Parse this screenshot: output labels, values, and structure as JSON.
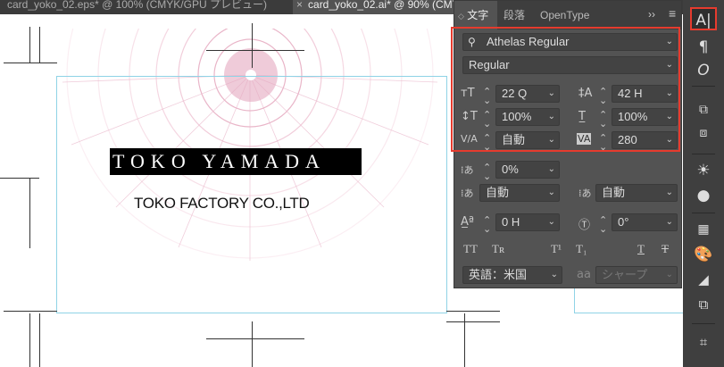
{
  "tabs": [
    {
      "label": "card_yoko_02.eps* @ 100% (CMYK/GPU プレビュー)",
      "active": false
    },
    {
      "label": "card_yoko_02.ai* @ 90% (CMYK",
      "active": true,
      "close": "×"
    }
  ],
  "canvas": {
    "name": "TOKO YAMADA",
    "company": "TOKO FACTORY CO.,LTD"
  },
  "panel": {
    "tabs": [
      "文字",
      "段落",
      "OpenType"
    ],
    "tab_prefix_icon": "◇",
    "collapse": "››",
    "menu": "≡",
    "font_family": "Athelas Regular",
    "font_style": "Regular",
    "font_size": "22 Q",
    "leading": "42 H",
    "vertical_scale": "100%",
    "horizontal_scale": "100%",
    "kerning": "自動",
    "tracking": "280",
    "tsume": "0%",
    "aki_left": "自動",
    "aki_right": "自動",
    "baseline_shift": "0 H",
    "rotation": "0°",
    "language": "英語：米国",
    "antialias_label": "aa",
    "antialias": "シャープ",
    "highlight_color": "#e63b2e"
  },
  "toolbar": {
    "icons": [
      "type-icon",
      "paragraph-icon",
      "opentype-icon",
      "transform-icon",
      "align-icon",
      "sun-icon",
      "appearance-icon",
      "swatches-icon",
      "color-palette-icon",
      "gradient-icon",
      "layers-icon",
      "artboard-icon"
    ]
  }
}
